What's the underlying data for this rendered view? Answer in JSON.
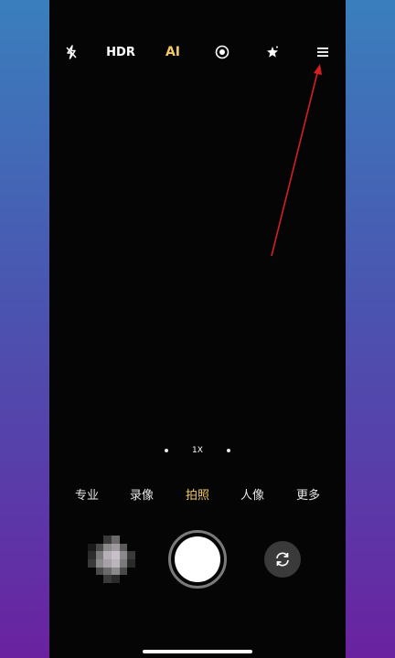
{
  "topbar": {
    "flash": {
      "icon": "flash-off-icon"
    },
    "hdr": {
      "label": "HDR"
    },
    "ai": {
      "label": "AI",
      "color": "#f3c868"
    },
    "live": {
      "icon": "live-photo-icon"
    },
    "beauty": {
      "icon": "magic-star-icon"
    },
    "menu": {
      "icon": "hamburger-menu-icon"
    }
  },
  "zoom": {
    "label": "1X"
  },
  "modes": [
    {
      "label": "专业"
    },
    {
      "label": "录像"
    },
    {
      "label": "拍照",
      "active": true
    },
    {
      "label": "人像"
    },
    {
      "label": "更多"
    }
  ],
  "controls": {
    "gallery": {
      "icon": "gallery-thumbnail"
    },
    "shutter": {
      "icon": "shutter-button"
    },
    "switch": {
      "icon": "switch-camera-icon"
    }
  },
  "colors": {
    "active_mode": "#f3c868",
    "annotation_arrow": "#d42020",
    "viewfinder": "#050505"
  }
}
